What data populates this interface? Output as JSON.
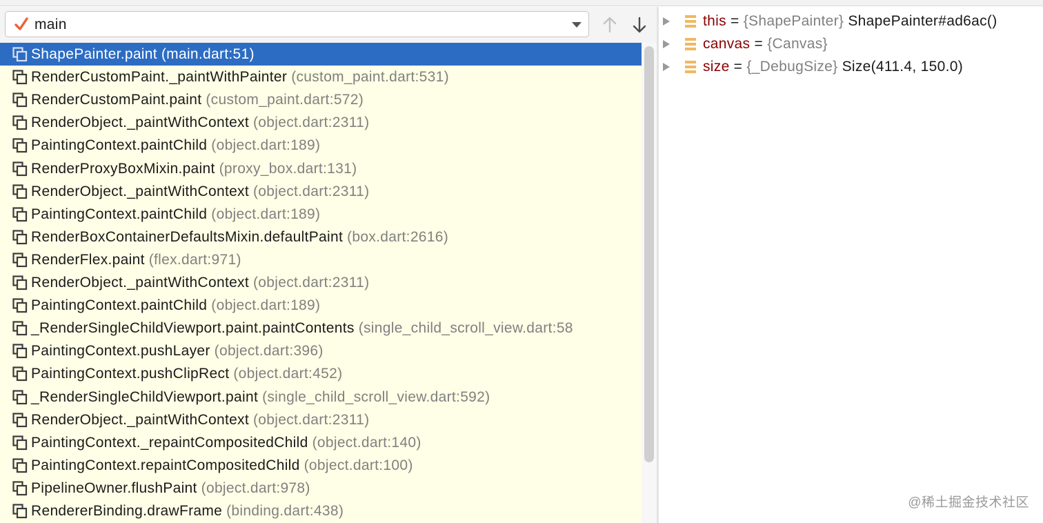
{
  "thread_selector": {
    "value": "main",
    "up_icon": "arrow-up-icon",
    "down_icon": "arrow-down-icon"
  },
  "frames": [
    {
      "method": "ShapePainter.paint",
      "location": "(main.dart:51)",
      "selected": true
    },
    {
      "method": "RenderCustomPaint._paintWithPainter",
      "location": "(custom_paint.dart:531)"
    },
    {
      "method": "RenderCustomPaint.paint",
      "location": "(custom_paint.dart:572)"
    },
    {
      "method": "RenderObject._paintWithContext",
      "location": "(object.dart:2311)"
    },
    {
      "method": "PaintingContext.paintChild",
      "location": "(object.dart:189)"
    },
    {
      "method": "RenderProxyBoxMixin.paint",
      "location": "(proxy_box.dart:131)"
    },
    {
      "method": "RenderObject._paintWithContext",
      "location": "(object.dart:2311)"
    },
    {
      "method": "PaintingContext.paintChild",
      "location": "(object.dart:189)"
    },
    {
      "method": "RenderBoxContainerDefaultsMixin.defaultPaint",
      "location": "(box.dart:2616)"
    },
    {
      "method": "RenderFlex.paint",
      "location": "(flex.dart:971)"
    },
    {
      "method": "RenderObject._paintWithContext",
      "location": "(object.dart:2311)"
    },
    {
      "method": "PaintingContext.paintChild",
      "location": "(object.dart:189)"
    },
    {
      "method": "_RenderSingleChildViewport.paint.paintContents",
      "location": "(single_child_scroll_view.dart:58"
    },
    {
      "method": "PaintingContext.pushLayer",
      "location": "(object.dart:396)"
    },
    {
      "method": "PaintingContext.pushClipRect",
      "location": "(object.dart:452)"
    },
    {
      "method": "_RenderSingleChildViewport.paint",
      "location": "(single_child_scroll_view.dart:592)"
    },
    {
      "method": "RenderObject._paintWithContext",
      "location": "(object.dart:2311)"
    },
    {
      "method": "PaintingContext._repaintCompositedChild",
      "location": "(object.dart:140)"
    },
    {
      "method": "PaintingContext.repaintCompositedChild",
      "location": "(object.dart:100)"
    },
    {
      "method": "PipelineOwner.flushPaint",
      "location": "(object.dart:978)"
    },
    {
      "method": "RendererBinding.drawFrame",
      "location": "(binding.dart:438)"
    }
  ],
  "variables": [
    {
      "name": "this",
      "eq": " = ",
      "type": "{ShapePainter}",
      "value": " ShapePainter#ad6ac()"
    },
    {
      "name": "canvas",
      "eq": " = ",
      "type": "{Canvas}",
      "value": ""
    },
    {
      "name": "size",
      "eq": " = ",
      "type": "{_DebugSize}",
      "value": " Size(411.4, 150.0)"
    }
  ],
  "watermark": "@稀土掘金技术社区",
  "colors": {
    "selection": "#2d6cc3",
    "frames_background": "#fffee6",
    "variable_name": "#8b0000",
    "check": "#e8643c",
    "field_icon": "#f0b860"
  }
}
